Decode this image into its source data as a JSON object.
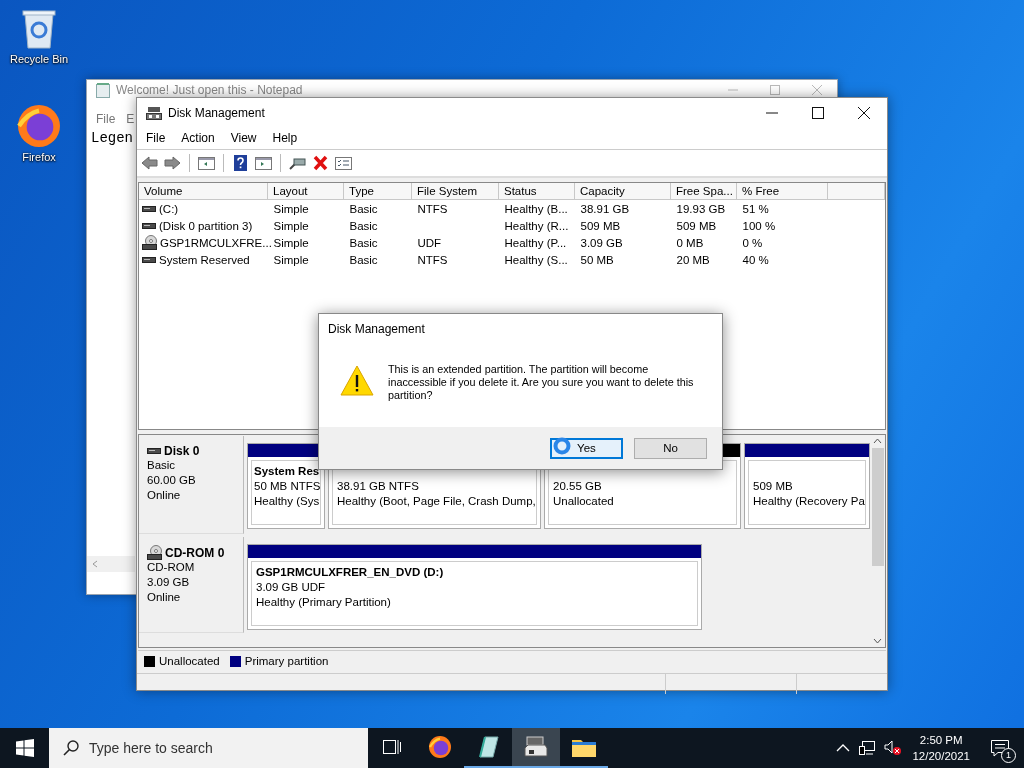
{
  "desktop_icons": [
    {
      "kind": "recycle",
      "label": "Recycle Bin"
    },
    {
      "kind": "firefox",
      "label": "Firefox"
    }
  ],
  "notepad": {
    "title": "Welcome! Just open this - Notepad",
    "menu": [
      "File",
      "E"
    ],
    "text": "Legen"
  },
  "window": {
    "title": "Disk Management",
    "menu": [
      "File",
      "Action",
      "View",
      "Help"
    ],
    "toolbar": [
      {
        "kind": "back"
      },
      {
        "kind": "forward"
      },
      {
        "kind": "sep"
      },
      {
        "kind": "tree"
      },
      {
        "kind": "sep"
      },
      {
        "kind": "help"
      },
      {
        "kind": "pane"
      },
      {
        "kind": "sep"
      },
      {
        "kind": "connect"
      },
      {
        "kind": "delete"
      },
      {
        "kind": "properties"
      }
    ],
    "table": {
      "columns": [
        "Volume",
        "Layout",
        "Type",
        "File System",
        "Status",
        "Capacity",
        "Free Spa...",
        "% Free"
      ],
      "rows": [
        {
          "kind": "disk",
          "cells": [
            " (C:)",
            "Simple",
            "Basic",
            "NTFS",
            "Healthy (B...",
            "38.91 GB",
            "19.93 GB",
            "51 %"
          ]
        },
        {
          "kind": "disk",
          "cells": [
            "(Disk 0 partition 3)",
            "Simple",
            "Basic",
            "",
            "Healthy (R...",
            "509 MB",
            "509 MB",
            "100 %"
          ]
        },
        {
          "kind": "cd",
          "cells": [
            "GSP1RMCULXFRE...",
            "Simple",
            "Basic",
            "UDF",
            "Healthy (P...",
            "3.09 GB",
            "0 MB",
            "0 %"
          ]
        },
        {
          "kind": "disk",
          "cells": [
            "System Reserved",
            "Simple",
            "Basic",
            "NTFS",
            "Healthy (S...",
            "50 MB",
            "20 MB",
            "40 %"
          ]
        }
      ]
    },
    "disks": [
      {
        "kind": "disk",
        "name": "Disk 0",
        "lines": [
          "Basic",
          "60.00 GB",
          "Online"
        ],
        "partitions": [
          {
            "kind": "primary",
            "name": "System Res",
            "lines": [
              "50 MB NTFS",
              "Healthy (Sys"
            ]
          },
          {
            "lines": [
              "38.91 GB NTFS",
              "Healthy (Boot, Page File, Crash Dump,"
            ]
          },
          {
            "kind": "unallocated",
            "lines": [
              "20.55 GB",
              "Unallocated"
            ]
          },
          {
            "kind": "primary",
            "lines": [
              "509 MB",
              "Healthy (Recovery Pa"
            ]
          }
        ]
      },
      {
        "kind": "cd",
        "name": "CD-ROM 0",
        "lines": [
          "CD-ROM",
          "3.09 GB",
          "Online"
        ],
        "partitions": [
          {
            "kind": "primary",
            "name": "GSP1RMCULXFRER_EN_DVD  (D:)",
            "lines": [
              "3.09 GB UDF",
              "Healthy (Primary Partition)"
            ]
          }
        ]
      }
    ],
    "legend": [
      {
        "label": "Unallocated",
        "color": "#000000"
      },
      {
        "label": "Primary partition",
        "color": "#000080"
      }
    ]
  },
  "dialog": {
    "title": "Disk Management",
    "message": "This is an extended partition. The partition will become inaccessible if you delete it. Are you sure you want to delete this partition?",
    "buttons": [
      {
        "label": "Yes",
        "selected": true
      },
      {
        "label": "No",
        "selected": false
      }
    ]
  },
  "taskbar": {
    "search_placeholder": "Type here to search",
    "apps": [
      {
        "kind": "taskview",
        "running": false,
        "selected": false
      },
      {
        "kind": "firefox",
        "running": false,
        "selected": false
      },
      {
        "kind": "notepad",
        "running": true,
        "selected": false
      },
      {
        "kind": "diskmgmt",
        "running": true,
        "selected": true
      },
      {
        "kind": "explorer",
        "running": true,
        "selected": false
      }
    ],
    "time": "2:50 PM",
    "date": "12/20/2021",
    "notifications": "1"
  }
}
